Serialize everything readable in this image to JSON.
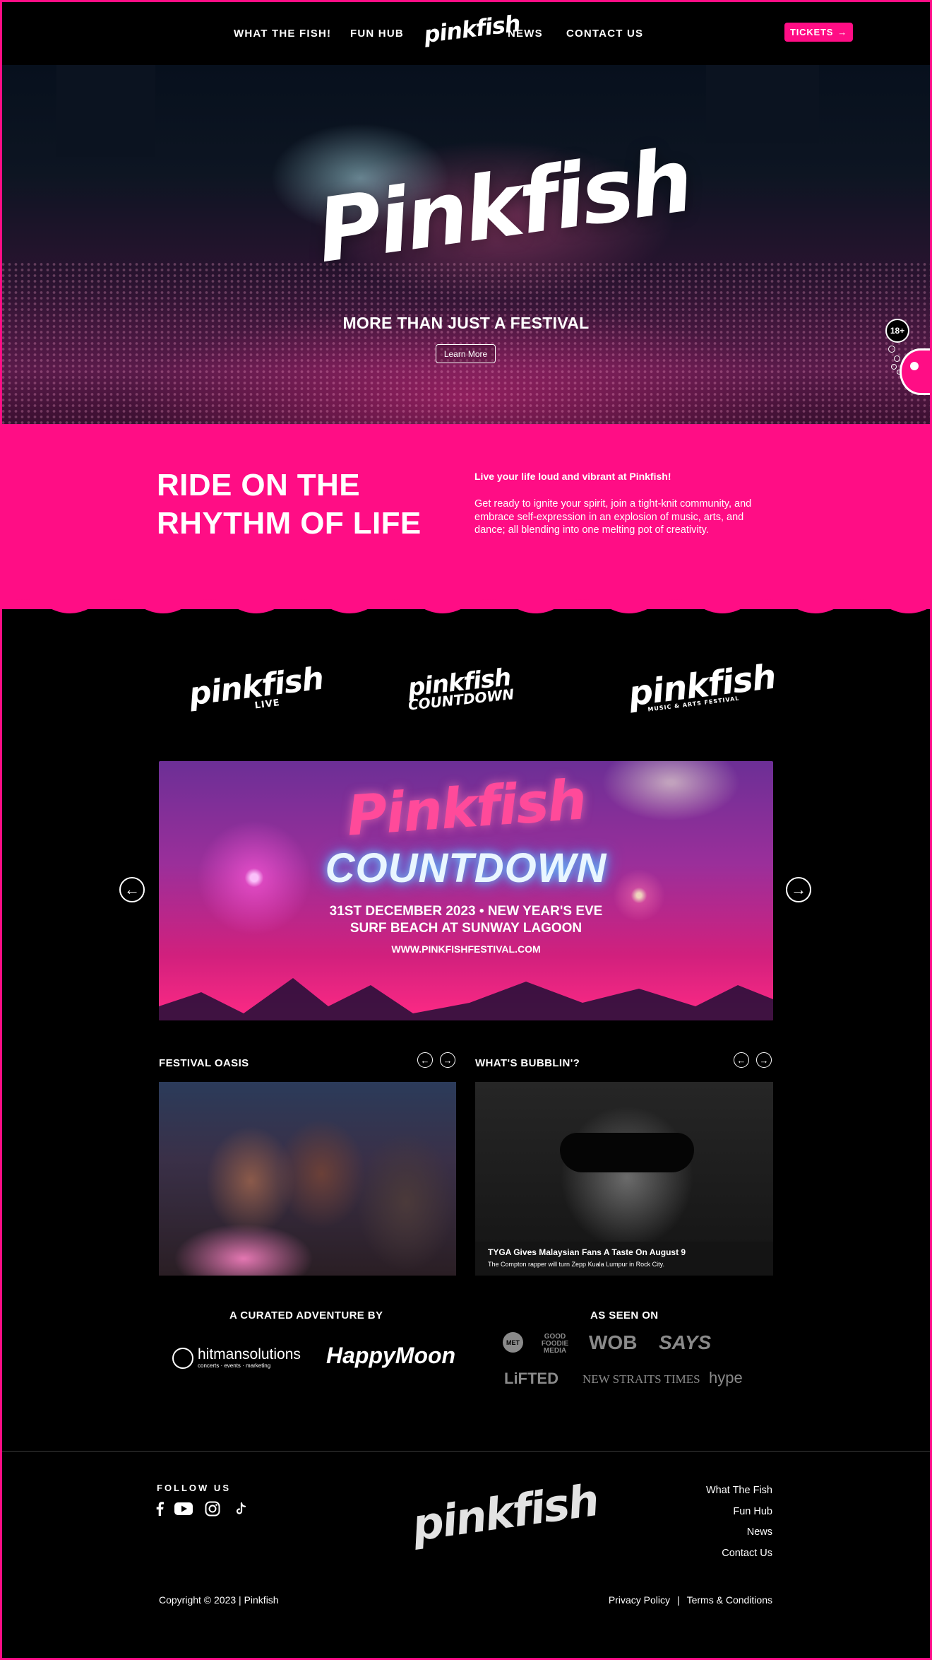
{
  "nav": {
    "links": [
      "WHAT THE FISH!",
      "FUN HUB",
      "NEWS",
      "CONTACT US"
    ],
    "logo": "pinkfish",
    "tickets_label": "TICKETS"
  },
  "hero": {
    "logo": "Pinkfish",
    "tagline": "MORE THAN JUST A FESTIVAL",
    "button": "Learn More",
    "age_badge": "18+"
  },
  "intro": {
    "title_line1": "RIDE ON THE",
    "title_line2": "RHYTHM OF LIFE",
    "subtitle": "Live your life loud and vibrant at Pinkfish!",
    "body": "Get ready to ignite your spirit, join a tight-knit community, and embrace self-expression in an explosion of music, arts, and dance; all blending into one melting pot of creativity."
  },
  "brands": [
    {
      "name": "pinkfish",
      "sub": "LIVE"
    },
    {
      "name": "pinkfish",
      "sub": "COUNTDOWN"
    },
    {
      "name": "pinkfish",
      "sub": "MUSIC & ARTS FESTIVAL"
    }
  ],
  "banner": {
    "title": "Pinkfish",
    "subtitle": "COUNTDOWN",
    "line1": "31ST DECEMBER 2023 • NEW YEAR'S EVE",
    "line2": "SURF BEACH AT SUNWAY LAGOON",
    "url": "WWW.PINKFISHFESTIVAL.COM"
  },
  "sections": {
    "oasis": "FESTIVAL OASIS",
    "bubblin": "WHAT'S BUBBLIN'?"
  },
  "news": {
    "title": "TYGA Gives Malaysian Fans A Taste On August 9",
    "sub": "The Compton rapper will turn Zepp Kuala Lumpur in Rock City."
  },
  "credits": {
    "curated_heading": "A CURATED ADVENTURE BY",
    "curators": [
      "hitmansolutions",
      "concerts · events · marketing",
      "HappyMoon"
    ],
    "seen_heading": "AS SEEN ON",
    "media": [
      "MET",
      "GOOD FOODIE MEDIA",
      "WOB",
      "SAYS",
      "LiFTED",
      "NEW STRAITS TIMES",
      "hype"
    ]
  },
  "footer": {
    "follow": "FOLLOW US",
    "logo": "pinkfish",
    "links": [
      "What The Fish",
      "Fun Hub",
      "News",
      "Contact Us"
    ],
    "copyright": "Copyright © 2023 | Pinkfish",
    "privacy": "Privacy Policy",
    "separator": "|",
    "terms": "Terms & Conditions"
  },
  "icons": {
    "social": [
      "facebook-icon",
      "youtube-icon",
      "instagram-icon",
      "tiktok-icon"
    ]
  },
  "colors": {
    "brand_pink": "#ff0d85",
    "background": "#000000"
  }
}
